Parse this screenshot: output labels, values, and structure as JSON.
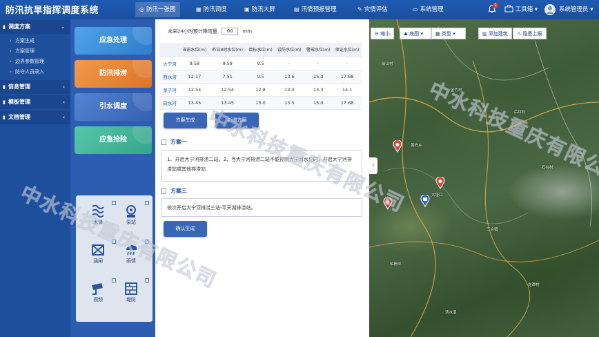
{
  "header": {
    "app_title": "防汛抗旱指挥调度系统",
    "nav": [
      {
        "label": "防汛一张图",
        "icon": "map-icon",
        "active": true
      },
      {
        "label": "防汛调度",
        "icon": "grid-icon",
        "active": false
      },
      {
        "label": "防汛大屏",
        "icon": "screen-icon",
        "active": false
      },
      {
        "label": "汛情预报管理",
        "icon": "doc-icon",
        "active": false
      },
      {
        "label": "灾情评估",
        "icon": "pencil-icon",
        "active": false
      },
      {
        "label": "系统管理",
        "icon": "folder-icon",
        "active": false
      }
    ],
    "notification_count": "1",
    "toolbox_label": "工具箱",
    "user_label": "系统管理员"
  },
  "sidebar": {
    "groups": [
      {
        "label": "调度方案",
        "icon": "book-icon",
        "expanded": true,
        "items": [
          {
            "label": "方案生成"
          },
          {
            "label": "方案管理"
          },
          {
            "label": "边界参数管理"
          },
          {
            "label": "防守人员录入"
          }
        ]
      },
      {
        "label": "信息管理",
        "icon": "file-icon",
        "expanded": false,
        "items": []
      },
      {
        "label": "模板管理",
        "icon": "file-icon",
        "expanded": false,
        "items": []
      },
      {
        "label": "文档管理",
        "icon": "file-icon",
        "expanded": false,
        "items": []
      }
    ]
  },
  "cards": [
    {
      "label": "应急处理",
      "color": "#3d8ed8"
    },
    {
      "label": "防汛排涝",
      "color": "#e8863a"
    },
    {
      "label": "引水调度",
      "color": "#3f6cc0"
    },
    {
      "label": "应急抢险",
      "color": "#3fb39a"
    }
  ],
  "icon_panel": [
    {
      "label": "水情",
      "icon": "water-icon",
      "checked": false
    },
    {
      "label": "泵站",
      "icon": "pump-icon",
      "checked": false
    },
    {
      "label": "涵闸",
      "icon": "sluice-icon",
      "checked": false
    },
    {
      "label": "雨情",
      "icon": "rain-icon",
      "checked": true
    },
    {
      "label": "视频",
      "icon": "camera-icon",
      "checked": false
    },
    {
      "label": "堤防",
      "icon": "dike-icon",
      "checked": false
    }
  ],
  "main": {
    "rain_label": "未来24小时预计降雨量",
    "rain_value": "00",
    "rain_unit": "mm",
    "table": {
      "headers": [
        "",
        "当前水位(m)",
        "昨日8时水位(m)",
        "目标水位(m)",
        "设防水位(m)",
        "警戒水位(m)",
        "保证水位(m)"
      ],
      "rows": [
        [
          "大宁河",
          "9.58",
          "9.58",
          "9.5",
          "-",
          "-",
          "-"
        ],
        [
          "西水河",
          "12.17",
          "7.51",
          "9.5",
          "13.6",
          "15.0",
          "17.68"
        ],
        [
          "菜子河",
          "12.54",
          "12.54",
          "12.8",
          "13.0",
          "13.3",
          "14.1"
        ],
        [
          "向水河",
          "13.45",
          "13.45",
          "13.0",
          "13.5",
          "15.0",
          "17.68"
        ]
      ]
    },
    "btn_generate": "方案生成",
    "btn_new": "新增方案",
    "plans": [
      {
        "title": "方案一",
        "text": "1、开启大宁河排涝二站。2、当大宁河排涝二站不能控制大宁河水位时，开启大宁河排涝站或其他排涝站"
      },
      {
        "title": "方案三",
        "text": "依次开启大宁河排涝三站-平天湖排涝站。"
      }
    ],
    "btn_confirm": "确认生成"
  },
  "map": {
    "toolbar": {
      "zoom_out": "缩小",
      "basemap": "底图",
      "type": "类型",
      "add_building": "添加建筑",
      "report_hazard": "隐患上报"
    },
    "labels": [
      "前山村",
      "金竹村",
      "后坪村",
      "黄岭乡",
      "石柱村",
      "大垭口",
      "三合镇",
      "柏杨坪",
      "龙潭村",
      "清水溪"
    ]
  },
  "watermark": "中水科技重庆有限公司"
}
